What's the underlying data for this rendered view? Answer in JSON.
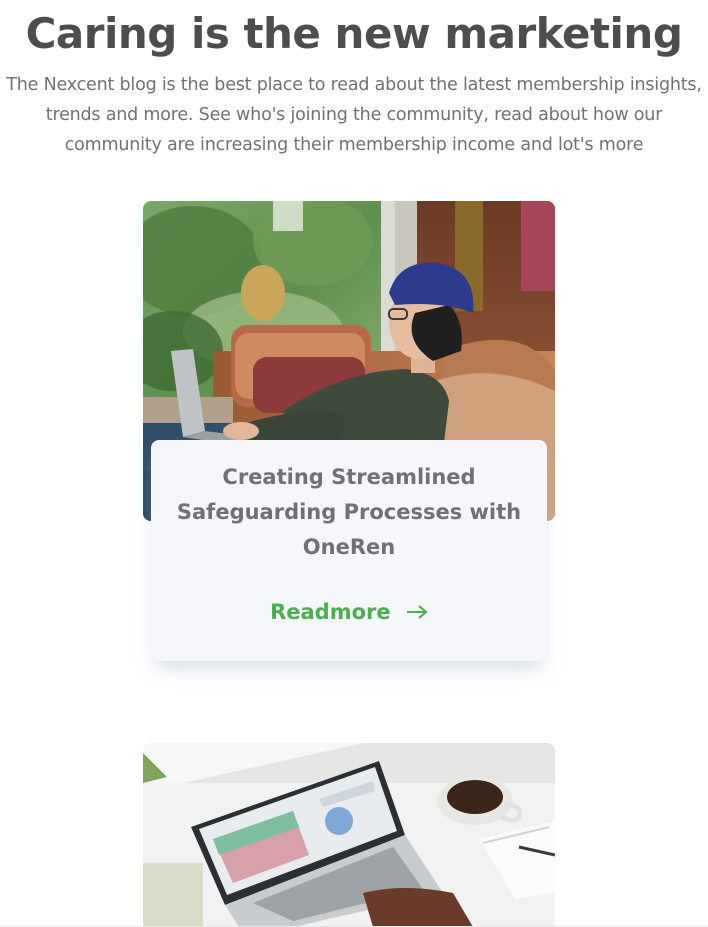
{
  "section": {
    "title": "Caring is the new marketing",
    "description": "The Nexcent blog is the best place to read about the latest membership insights, trends and more. See who's joining the community, read about how our community are increasing their membership income and lot's more"
  },
  "cards": [
    {
      "title": "Creating Streamlined Safeguarding Processes with OneRen",
      "link_label": "Readmore",
      "link_icon": "arrow-right-icon"
    }
  ],
  "colors": {
    "heading": "#4d4d4d",
    "body_text": "#717171",
    "accent": "#4caf4f",
    "card_background": "#f5f7fa"
  }
}
